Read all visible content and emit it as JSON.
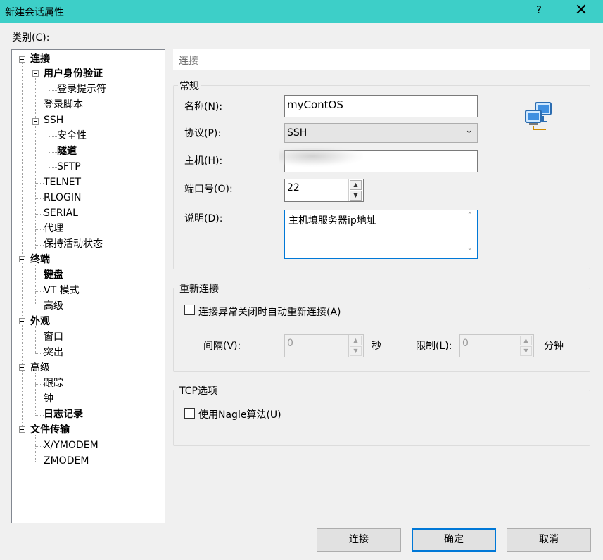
{
  "window": {
    "title": "新建会话属性",
    "help": "?",
    "close": "✕"
  },
  "category_label": "类别(C):",
  "tree": {
    "connection": "连接",
    "auth": "用户身份验证",
    "login_prompt": "登录提示符",
    "login_script": "登录脚本",
    "ssh": "SSH",
    "security": "安全性",
    "tunnel": "隧道",
    "sftp": "SFTP",
    "telnet": "TELNET",
    "rlogin": "RLOGIN",
    "serial": "SERIAL",
    "proxy": "代理",
    "keepalive": "保持活动状态",
    "terminal": "终端",
    "keyboard": "键盘",
    "vt_mode": "VT 模式",
    "advanced": "高级",
    "appearance": "外观",
    "window": "窗口",
    "highlight": "突出",
    "advanced2": "高级",
    "trace": "跟踪",
    "bell": "钟",
    "log": "日志记录",
    "file_transfer": "文件传输",
    "xymodem": "X/YMODEM",
    "zmodem": "ZMODEM"
  },
  "header": "连接",
  "general": {
    "title": "常规",
    "name_label": "名称(N):",
    "name_value": "myContOS",
    "protocol_label": "协议(P):",
    "protocol_value": "SSH",
    "host_label": "主机(H):",
    "host_value": "",
    "port_label": "端口号(O):",
    "port_value": "22",
    "desc_label": "说明(D):",
    "desc_value": "主机填服务器ip地址"
  },
  "reconnect": {
    "title": "重新连接",
    "checkbox_label": "连接异常关闭时自动重新连接(A)",
    "interval_label": "间隔(V):",
    "interval_value": "0",
    "interval_unit": "秒",
    "limit_label": "限制(L):",
    "limit_value": "0",
    "limit_unit": "分钟"
  },
  "tcp": {
    "title": "TCP选项",
    "nagle_label": "使用Nagle算法(U)"
  },
  "buttons": {
    "connect": "连接",
    "ok": "确定",
    "cancel": "取消"
  },
  "icons": {
    "network": "network-computers-icon"
  }
}
